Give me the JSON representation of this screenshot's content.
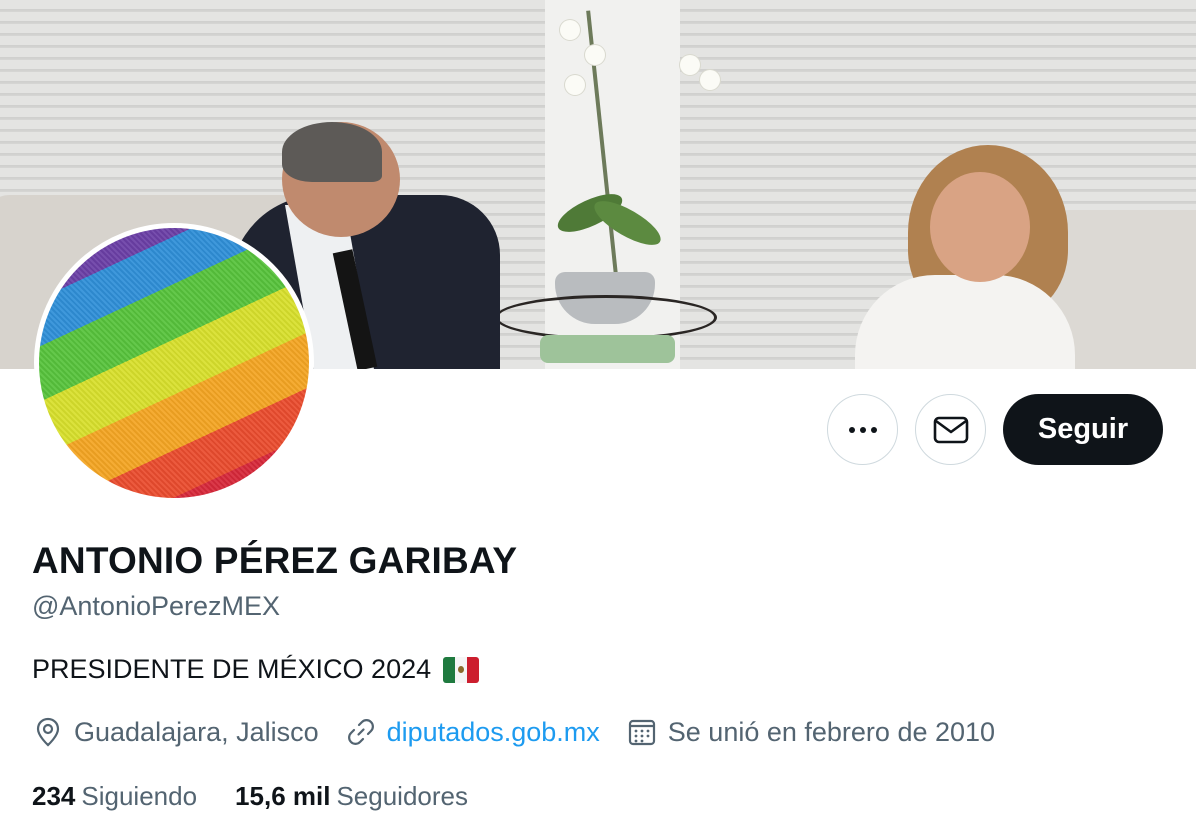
{
  "profile": {
    "name": "ANTONIO PÉREZ GARIBAY",
    "handle": "@AntonioPerezMEX",
    "bio": "PRESIDENTE DE MÉXICO 2024",
    "bio_flag_icon": "mexico-flag-icon",
    "location": "Guadalajara, Jalisco",
    "website": "diputados.gob.mx",
    "joined": "Se unió en febrero de 2010"
  },
  "actions": {
    "more_icon": "more-dots-icon",
    "message_icon": "envelope-icon",
    "follow_label": "Seguir"
  },
  "stats": {
    "following_count": "234",
    "following_label": "Siguiendo",
    "followers_count": "15,6 mil",
    "followers_label": "Seguidores"
  },
  "colors": {
    "text_primary": "#0f1419",
    "text_secondary": "#536471",
    "link": "#1d9bf0",
    "follow_button_bg": "#0f1419",
    "border": "#cfd9de"
  }
}
